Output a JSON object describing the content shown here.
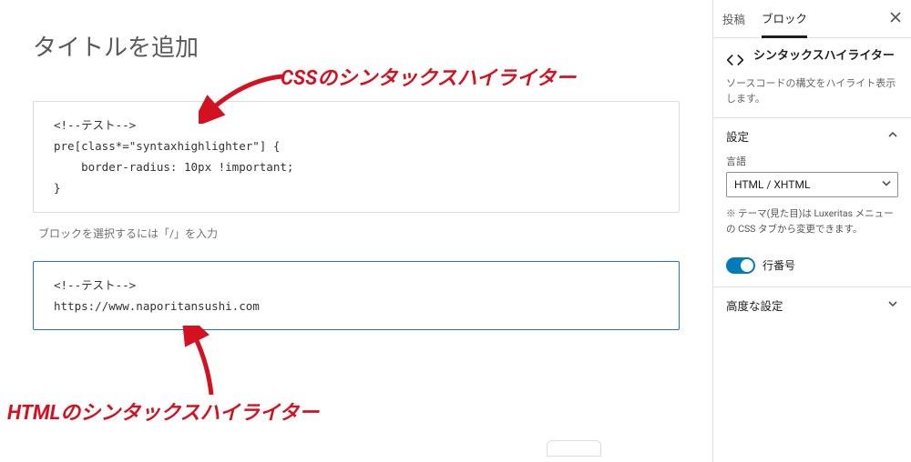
{
  "editor": {
    "title_placeholder": "タイトルを追加",
    "code1_l1": "<!--テスト-->",
    "code1_l2": "pre[class*=\"syntaxhighlighter\"] {",
    "code1_l3": "    border-radius: 10px !important;",
    "code1_l4": "}",
    "prompt": "ブロックを選択するには「/」を入力",
    "code2_l1": "<!--テスト-->",
    "code2_l2": "https://www.naporitansushi.com"
  },
  "annotations": {
    "css_label": "CSSのシンタックスハイライター",
    "html_label": "HTMLのシンタックスハイライター"
  },
  "sidebar": {
    "tab_post": "投稿",
    "tab_block": "ブロック",
    "block_title": "シンタックスハイライター",
    "block_desc": "ソースコードの構文をハイライト表示します。",
    "section_settings": "設定",
    "lang_label": "言語",
    "lang_value": "HTML / XHTML",
    "theme_note": "※ テーマ(見た目)は Luxeritas メニューの CSS タブから変更できます。",
    "line_numbers": "行番号",
    "section_advanced": "高度な設定"
  }
}
